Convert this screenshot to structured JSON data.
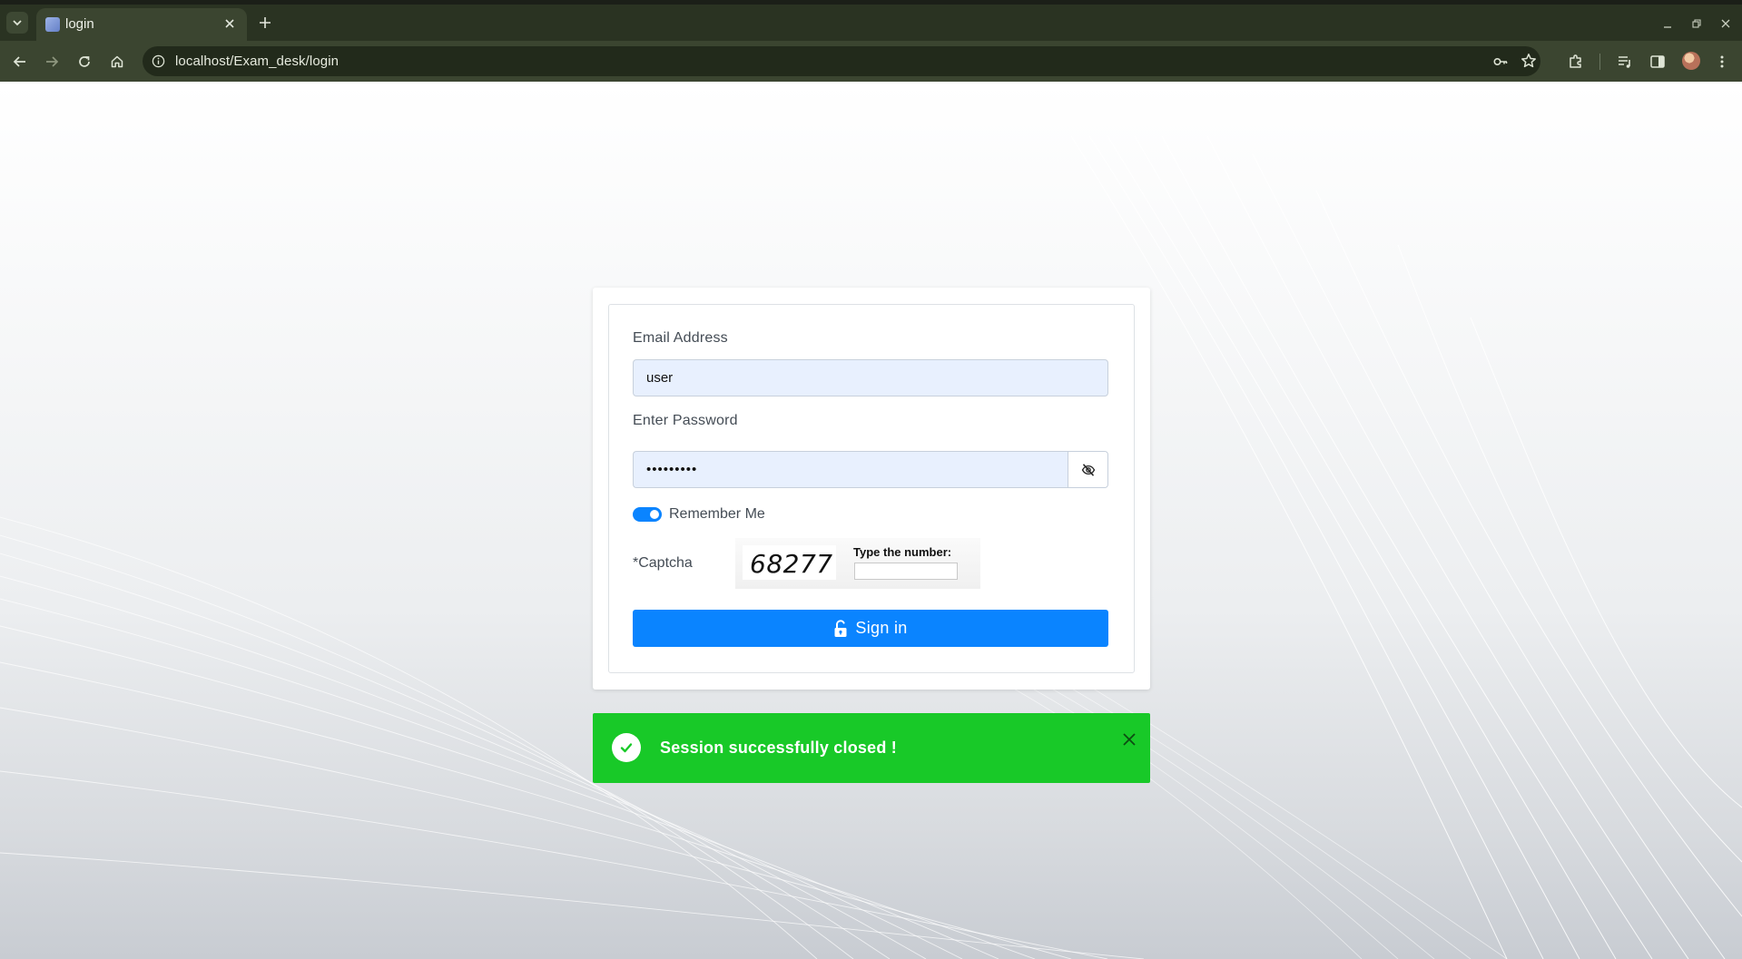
{
  "browser": {
    "tab_title": "login",
    "url": "localhost/Exam_desk/login",
    "theme_color": "#3b4530"
  },
  "login_form": {
    "email_label": "Email Address",
    "email_value": "user",
    "password_label": "Enter Password",
    "password_value": "•••••••••",
    "remember_label": "Remember Me",
    "remember_checked": true,
    "captcha_label": "*Captcha",
    "captcha_number": "68277",
    "captcha_prompt": "Type the number:",
    "captcha_input_value": "",
    "signin_label": "Sign in",
    "accent_color": "#0a84ff"
  },
  "toast": {
    "message": "Session successfully closed !",
    "color": "#18c928"
  }
}
